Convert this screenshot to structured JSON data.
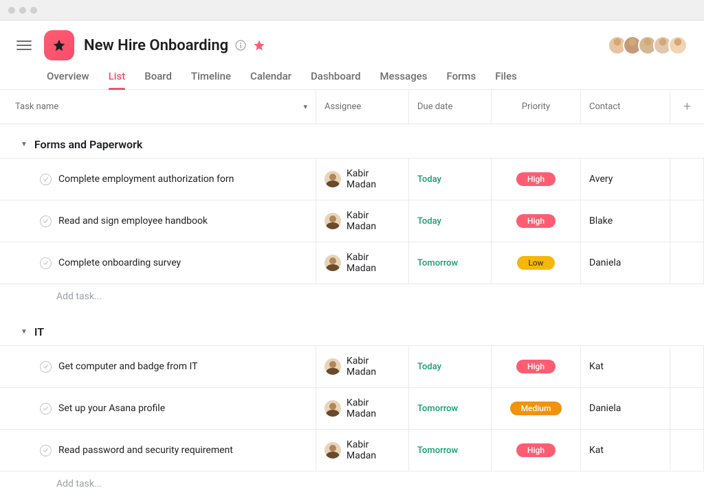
{
  "project": {
    "title": "New Hire Onboarding"
  },
  "tabs": [
    "Overview",
    "List",
    "Board",
    "Timeline",
    "Calendar",
    "Dashboard",
    "Messages",
    "Forms",
    "Files"
  ],
  "active_tab": 1,
  "columns": {
    "task": "Task name",
    "assignee": "Assignee",
    "due": "Due date",
    "priority": "Priority",
    "contact": "Contact"
  },
  "avatars": [
    "#e8c4a0",
    "#c49a7a",
    "#d4b896",
    "#e0c8b0",
    "#f0d4b4"
  ],
  "sections": [
    {
      "name": "Forms and Paperwork",
      "tasks": [
        {
          "title": "Complete employment authorization forn",
          "assignee": "Kabir Madan",
          "due": "Today",
          "priority": "High",
          "priority_class": "high",
          "contact": "Avery"
        },
        {
          "title": "Read and sign employee handbook",
          "assignee": "Kabir Madan",
          "due": "Today",
          "priority": "High",
          "priority_class": "high",
          "contact": "Blake"
        },
        {
          "title": "Complete onboarding survey",
          "assignee": "Kabir Madan",
          "due": "Tomorrow",
          "priority": "Low",
          "priority_class": "low",
          "contact": "Daniela"
        }
      ],
      "add_label": "Add task..."
    },
    {
      "name": "IT",
      "tasks": [
        {
          "title": "Get computer and badge from IT",
          "assignee": "Kabir Madan",
          "due": "Today",
          "priority": "High",
          "priority_class": "high",
          "contact": "Kat"
        },
        {
          "title": "Set up your Asana profile",
          "assignee": "Kabir Madan",
          "due": "Tomorrow",
          "priority": "Medium",
          "priority_class": "medium",
          "contact": "Daniela"
        },
        {
          "title": "Read password and security requirement",
          "assignee": "Kabir Madan",
          "due": "Tomorrow",
          "priority": "High",
          "priority_class": "high",
          "contact": "Kat"
        }
      ],
      "add_label": "Add task..."
    }
  ]
}
